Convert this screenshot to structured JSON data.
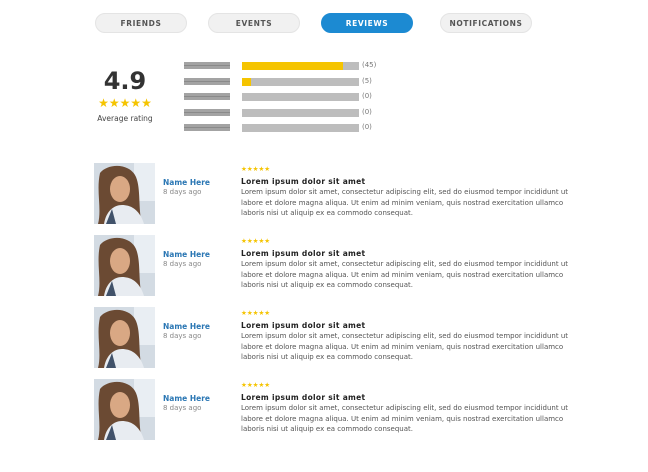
{
  "tabs": [
    {
      "label": "FRIENDS",
      "active": false
    },
    {
      "label": "EVENTS",
      "active": false
    },
    {
      "label": "REVIEWS",
      "active": true
    },
    {
      "label": "NOTIFICATIONS",
      "active": false
    }
  ],
  "summary": {
    "score": "4.9",
    "stars": "★★★★★",
    "label": "Average rating"
  },
  "rating_bars": [
    {
      "count_label": "(45)",
      "fill_fraction": 0.86
    },
    {
      "count_label": "(5)",
      "fill_fraction": 0.08
    },
    {
      "count_label": "(0)",
      "fill_fraction": 0
    },
    {
      "count_label": "(0)",
      "fill_fraction": 0
    },
    {
      "count_label": "(0)",
      "fill_fraction": 0
    }
  ],
  "reviews": [
    {
      "stars": "★★★★★",
      "name": "Name Here",
      "date": "8 days ago",
      "title": "Lorem ipsum dolor sit amet",
      "body": "Lorem ipsum dolor sit amet, consectetur adipiscing elit, sed do eiusmod tempor incididunt ut labore et dolore magna aliqua. Ut enim ad minim veniam, quis nostrad exercitation ullamco laboris nisi ut aliquip ex ea commodo consequat."
    },
    {
      "stars": "★★★★★",
      "name": "Name Here",
      "date": "8 days ago",
      "title": "Lorem ipsum dolor sit amet",
      "body": "Lorem ipsum dolor sit amet, consectetur adipiscing elit, sed do eiusmod tempor incididunt ut labore et dolore magna aliqua. Ut enim ad minim veniam, quis nostrad exercitation ullamco laboris nisi ut aliquip ex ea commodo consequat."
    },
    {
      "stars": "★★★★★",
      "name": "Name Here",
      "date": "8 days ago",
      "title": "Lorem ipsum dolor sit amet",
      "body": "Lorem ipsum dolor sit amet, consectetur adipiscing elit, sed do eiusmod tempor incididunt ut labore et dolore magna aliqua. Ut enim ad minim veniam, quis nostrad exercitation ullamco laboris nisi ut aliquip ex ea commodo consequat."
    },
    {
      "stars": "★★★★★",
      "name": "Name Here",
      "date": "8 days ago",
      "title": "Lorem ipsum dolor sit amet",
      "body": "Lorem ipsum dolor sit amet, consectetur adipiscing elit, sed do eiusmod tempor incididunt ut labore et dolore magna aliqua. Ut enim ad minim veniam, quis nostrad exercitation ullamco laboris nisi ut aliquip ex ea commodo consequat."
    }
  ],
  "colors": {
    "accent": "#1c8ad2",
    "star": "#f5c400",
    "name_link": "#2b77b4"
  }
}
